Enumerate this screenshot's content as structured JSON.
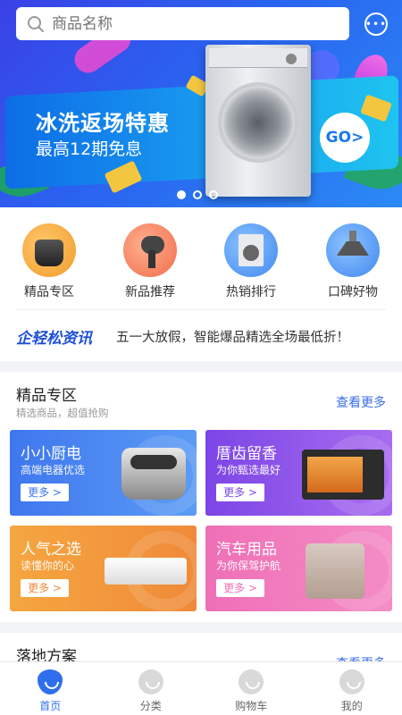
{
  "search": {
    "placeholder": "商品名称"
  },
  "banner": {
    "title": "冰洗返场特惠",
    "subtitle": "最高12期免息",
    "cta": "GO>",
    "slides": 3,
    "active_slide": 1
  },
  "categories": [
    {
      "label": "精品专区",
      "icon": "rice-cooker-icon"
    },
    {
      "label": "新品推荐",
      "icon": "hair-dryer-icon"
    },
    {
      "label": "热销排行",
      "icon": "washing-machine-icon"
    },
    {
      "label": "口碑好物",
      "icon": "range-hood-icon"
    }
  ],
  "news": {
    "logo": "企轻松资讯",
    "text": "五一大放假，智能爆品精选全场最低折！"
  },
  "section": {
    "title": "精品专区",
    "subtitle": "精选商品，超值抢购",
    "more": "查看更多",
    "tiles": [
      {
        "title": "小小厨电",
        "subtitle": "高端电器优选",
        "more": "更多 >"
      },
      {
        "title": "厝齿留香",
        "subtitle": "为你甄选最好",
        "more": "更多 >"
      },
      {
        "title": "人气之选",
        "subtitle": "读懂你的心",
        "more": "更多 >"
      },
      {
        "title": "汽车用品",
        "subtitle": "为你保驾护航",
        "more": "更多 >"
      }
    ]
  },
  "section2": {
    "title": "落地方案",
    "more": "查看更多"
  },
  "tabbar": [
    {
      "label": "首页",
      "active": true
    },
    {
      "label": "分类"
    },
    {
      "label": "购物车"
    },
    {
      "label": "我的"
    }
  ],
  "colors": {
    "accent": "#2f6fee",
    "tile_blue": "#3f77ee",
    "tile_purple": "#7c45e6",
    "tile_orange": "#f08a3a",
    "tile_pink": "#ef6fb6"
  }
}
